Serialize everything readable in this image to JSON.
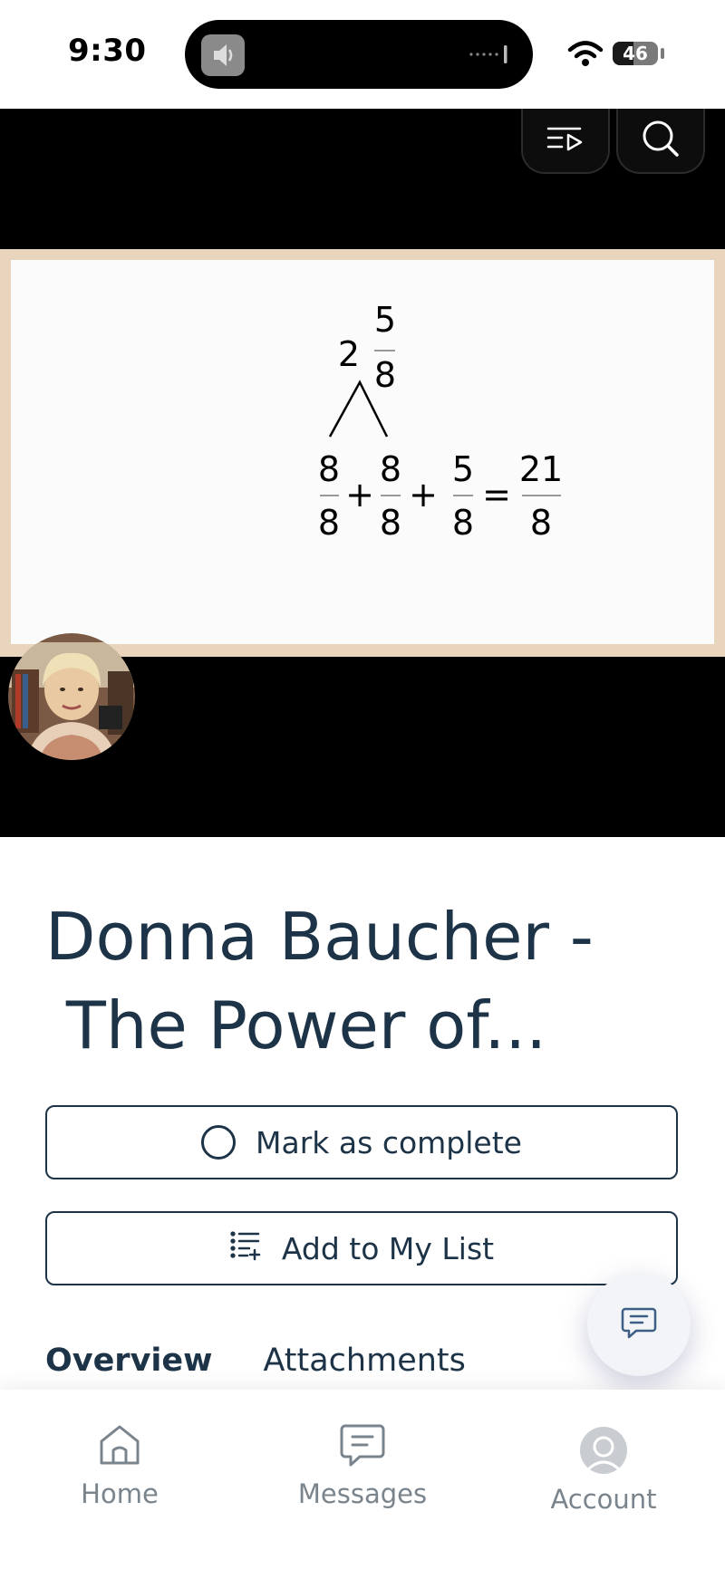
{
  "status_bar": {
    "time": "9:30",
    "battery": "46",
    "battery_level": 0.46
  },
  "player": {
    "slide_equation": {
      "whole": "2",
      "numerator": "5",
      "denominator": "8",
      "terms": [
        {
          "num": "8",
          "den": "8"
        },
        {
          "op": "+"
        },
        {
          "num": "8",
          "den": "8"
        },
        {
          "op": "+"
        },
        {
          "num": "5",
          "den": "8"
        },
        {
          "op": "="
        },
        {
          "num": "21",
          "den": "8"
        }
      ]
    },
    "icons": {
      "playlist": "playlist-icon",
      "search": "search-icon"
    }
  },
  "lesson": {
    "title_line1": "Donna Baucher -",
    "title_line2": " The Power of...",
    "mark_complete_label": "Mark as complete",
    "add_to_list_label": "Add to My List"
  },
  "tabs": [
    "Overview",
    "Attachments"
  ],
  "bottom_nav": [
    {
      "label": "Home",
      "icon": "home-icon"
    },
    {
      "label": "Messages",
      "icon": "messages-icon"
    },
    {
      "label": "Account",
      "icon": "account-icon"
    }
  ],
  "colors": {
    "primary": "#1d3347",
    "nav_gray": "#7a848d",
    "frame_beige": "#e9d4bd"
  }
}
